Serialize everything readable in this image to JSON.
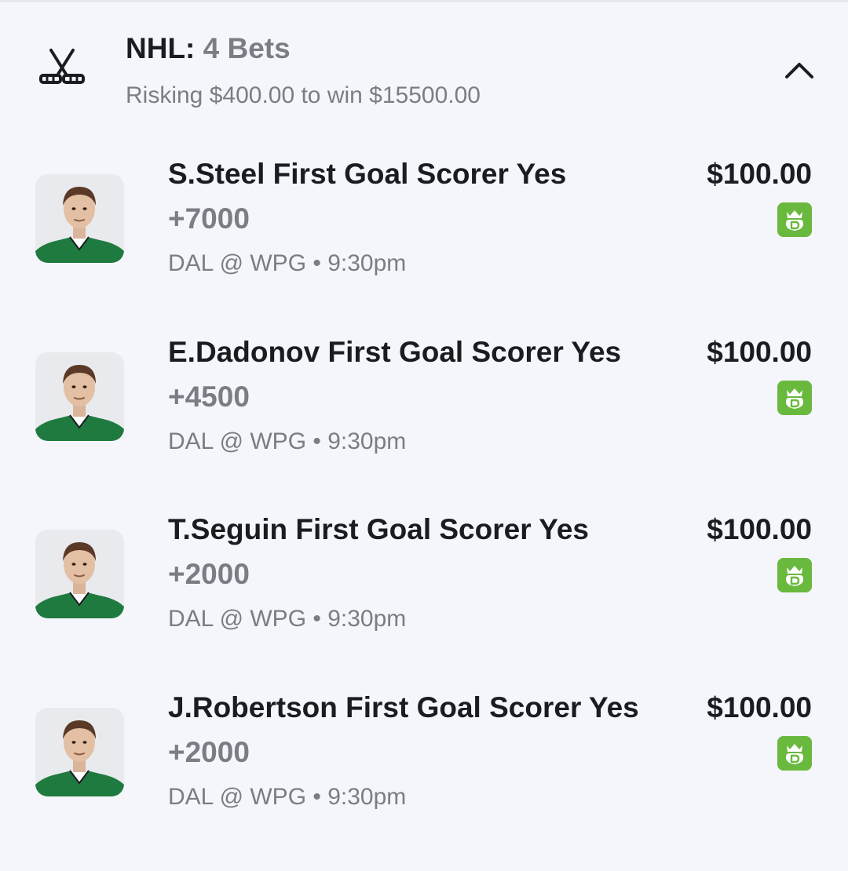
{
  "header": {
    "league": "NHL:",
    "bet_count": "4 Bets",
    "summary": "Risking $400.00 to win $15500.00",
    "sport_icon": "hockey-sticks-icon",
    "collapse_icon": "chevron-up-icon"
  },
  "colors": {
    "background": "#f5f6fb",
    "primary_text": "#1b1c20",
    "secondary_text": "#7c7d84",
    "book_badge": "#6ab93f",
    "jersey_green": "#1f7a3f"
  },
  "bets": [
    {
      "selection": "S.Steel First Goal Scorer Yes",
      "odds": "+7000",
      "matchup": "DAL @ WPG • 9:30pm",
      "stake": "$100.00",
      "book_icon": "draftkings-crown-icon"
    },
    {
      "selection": "E.Dadonov First Goal Scorer Yes",
      "odds": "+4500",
      "matchup": "DAL @ WPG • 9:30pm",
      "stake": "$100.00",
      "book_icon": "draftkings-crown-icon"
    },
    {
      "selection": "T.Seguin First Goal Scorer Yes",
      "odds": "+2000",
      "matchup": "DAL @ WPG • 9:30pm",
      "stake": "$100.00",
      "book_icon": "draftkings-crown-icon"
    },
    {
      "selection": "J.Robertson First Goal Scorer Yes",
      "odds": "+2000",
      "matchup": "DAL @ WPG • 9:30pm",
      "stake": "$100.00",
      "book_icon": "draftkings-crown-icon"
    }
  ]
}
